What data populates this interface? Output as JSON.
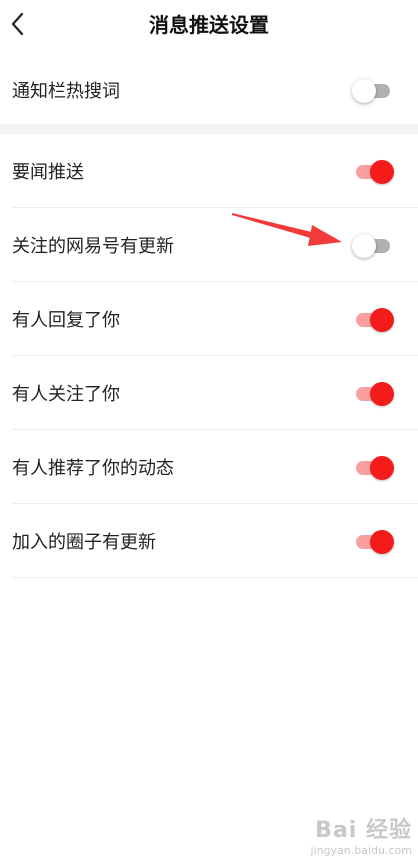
{
  "header": {
    "title": "消息推送设置"
  },
  "colors": {
    "accent_red": "#f41b1b",
    "accent_red_track": "#f8a0a0",
    "off_track": "#b0b0b0",
    "annotation_arrow": "#f33a3a"
  },
  "settings": [
    {
      "label": "通知栏热搜词",
      "on": false
    },
    {
      "label": "要闻推送",
      "on": true
    },
    {
      "label": "关注的网易号有更新",
      "on": false
    },
    {
      "label": "有人回复了你",
      "on": true
    },
    {
      "label": "有人关注了你",
      "on": true
    },
    {
      "label": "有人推荐了你的动态",
      "on": true
    },
    {
      "label": "加入的圈子有更新",
      "on": true
    }
  ],
  "watermark": {
    "main": "Bai 经验",
    "sub": "jingyan.baidu.com"
  }
}
